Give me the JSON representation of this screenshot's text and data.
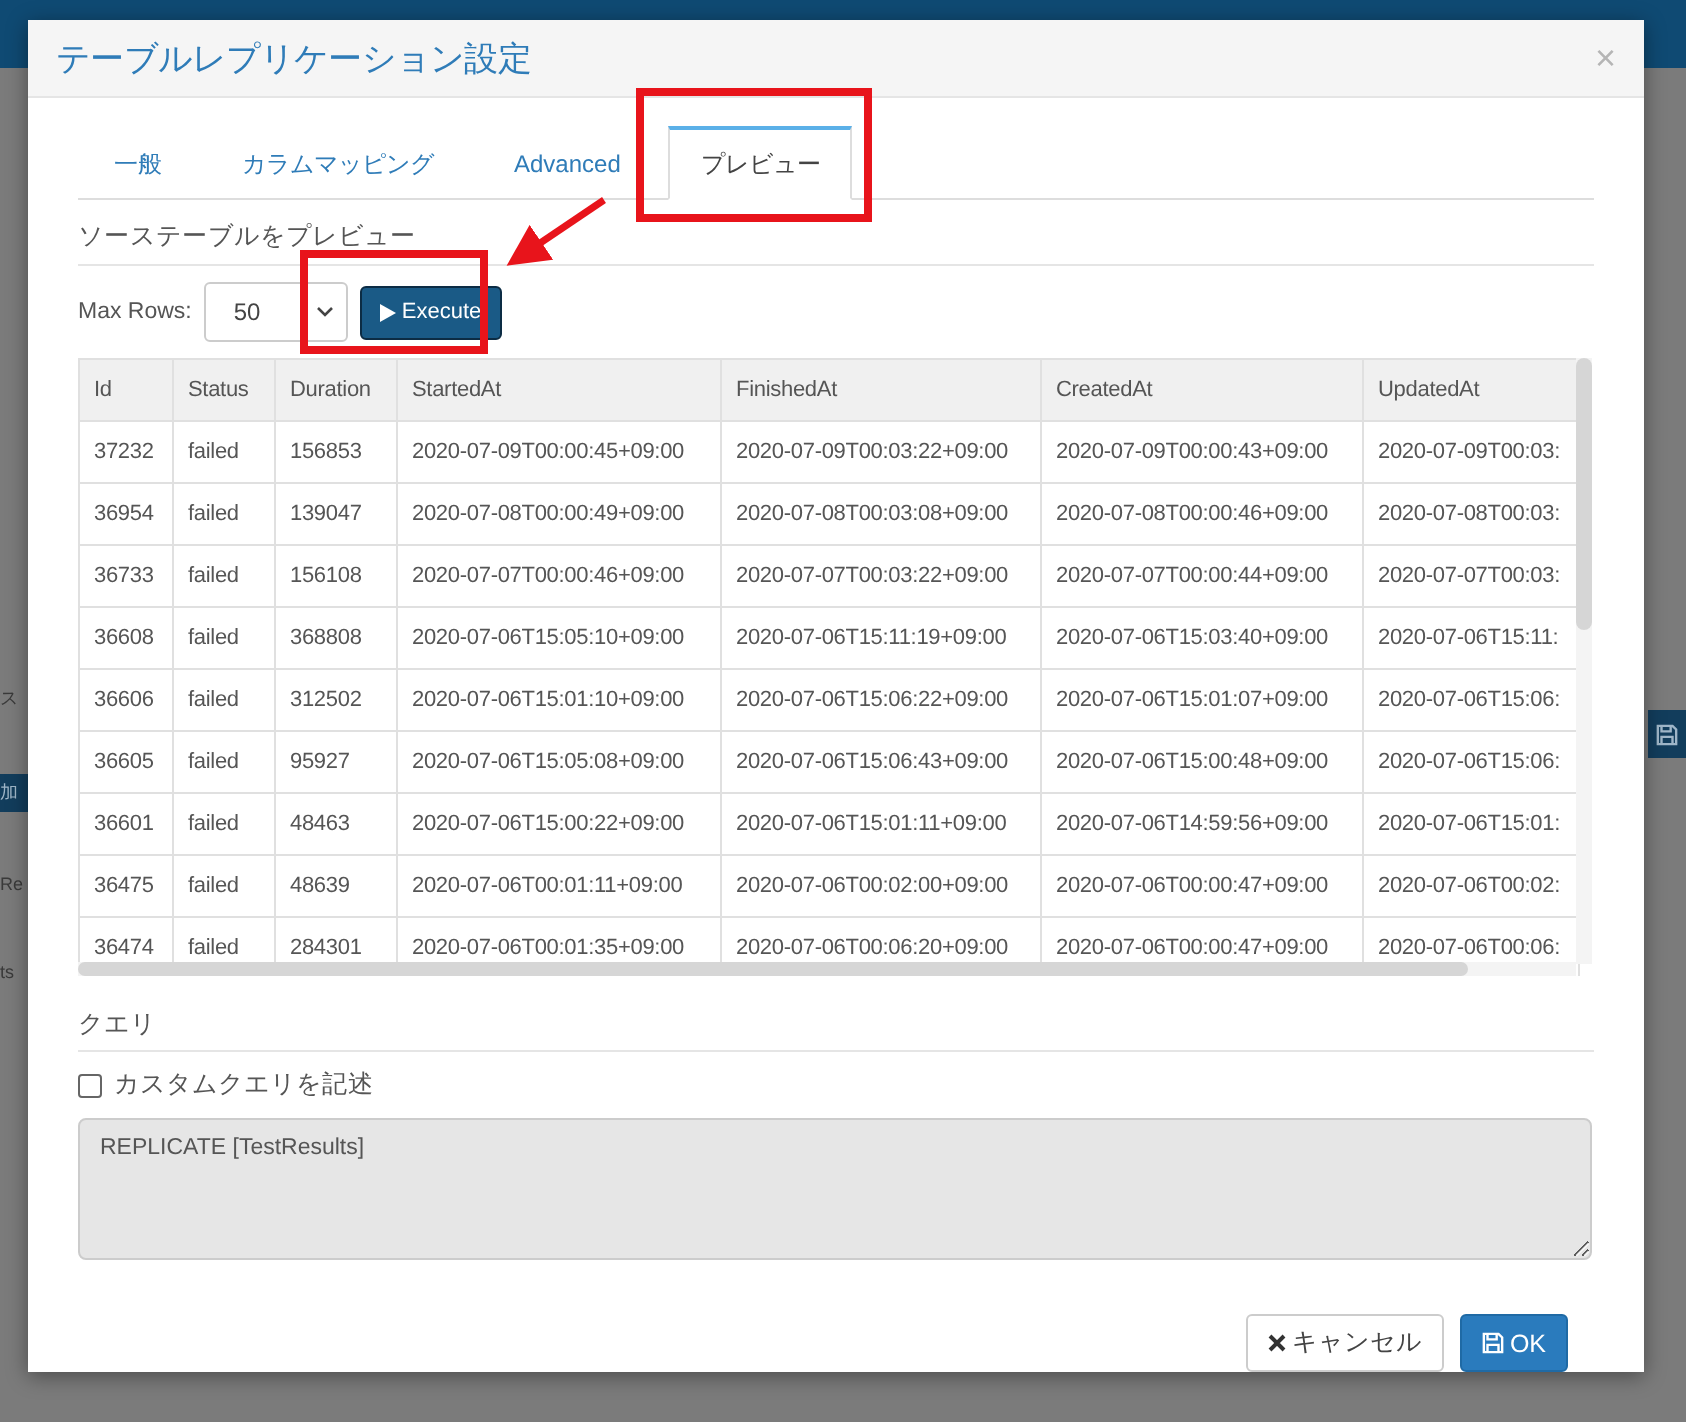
{
  "background": {
    "fragments": [
      {
        "text": "ス",
        "kind": "text"
      },
      {
        "text": "加",
        "kind": "button"
      },
      {
        "text": "Re",
        "kind": "text"
      },
      {
        "text": "ts",
        "kind": "text"
      }
    ]
  },
  "dialog": {
    "title": "テーブルレプリケーション設定",
    "close": "×",
    "tabs": [
      {
        "label": "一般",
        "selected": false
      },
      {
        "label": "カラムマッピング",
        "selected": false
      },
      {
        "label": "Advanced",
        "selected": false
      },
      {
        "label": "プレビュー",
        "selected": true
      }
    ],
    "preview": {
      "heading": "ソーステーブルをプレビュー",
      "max_rows_label": "Max Rows:",
      "max_rows": "50",
      "execute": "Execute",
      "table": {
        "columns": [
          "Id",
          "Status",
          "Duration",
          "StartedAt",
          "FinishedAt",
          "CreatedAt",
          "UpdatedAt"
        ],
        "rows": [
          [
            "37232",
            "failed",
            "156853",
            "2020-07-09T00:00:45+09:00",
            "2020-07-09T00:03:22+09:00",
            "2020-07-09T00:00:43+09:00",
            "2020-07-09T00:03:"
          ],
          [
            "36954",
            "failed",
            "139047",
            "2020-07-08T00:00:49+09:00",
            "2020-07-08T00:03:08+09:00",
            "2020-07-08T00:00:46+09:00",
            "2020-07-08T00:03:"
          ],
          [
            "36733",
            "failed",
            "156108",
            "2020-07-07T00:00:46+09:00",
            "2020-07-07T00:03:22+09:00",
            "2020-07-07T00:00:44+09:00",
            "2020-07-07T00:03:"
          ],
          [
            "36608",
            "failed",
            "368808",
            "2020-07-06T15:05:10+09:00",
            "2020-07-06T15:11:19+09:00",
            "2020-07-06T15:03:40+09:00",
            "2020-07-06T15:11:"
          ],
          [
            "36606",
            "failed",
            "312502",
            "2020-07-06T15:01:10+09:00",
            "2020-07-06T15:06:22+09:00",
            "2020-07-06T15:01:07+09:00",
            "2020-07-06T15:06:"
          ],
          [
            "36605",
            "failed",
            "95927",
            "2020-07-06T15:05:08+09:00",
            "2020-07-06T15:06:43+09:00",
            "2020-07-06T15:00:48+09:00",
            "2020-07-06T15:06:"
          ],
          [
            "36601",
            "failed",
            "48463",
            "2020-07-06T15:00:22+09:00",
            "2020-07-06T15:01:11+09:00",
            "2020-07-06T14:59:56+09:00",
            "2020-07-06T15:01:"
          ],
          [
            "36475",
            "failed",
            "48639",
            "2020-07-06T00:01:11+09:00",
            "2020-07-06T00:02:00+09:00",
            "2020-07-06T00:00:47+09:00",
            "2020-07-06T00:02:"
          ],
          [
            "36474",
            "failed",
            "284301",
            "2020-07-06T00:01:35+09:00",
            "2020-07-06T00:06:20+09:00",
            "2020-07-06T00:00:47+09:00",
            "2020-07-06T00:06:"
          ]
        ]
      }
    },
    "query": {
      "heading": "クエリ",
      "custom_label": "カスタムクエリを記述",
      "custom_checked": false,
      "value": "REPLICATE [TestResults]",
      "disabled": true
    },
    "buttons": [
      {
        "label": "キャンセル",
        "kind": "cancel"
      },
      {
        "label": "OK",
        "kind": "primary"
      }
    ]
  }
}
